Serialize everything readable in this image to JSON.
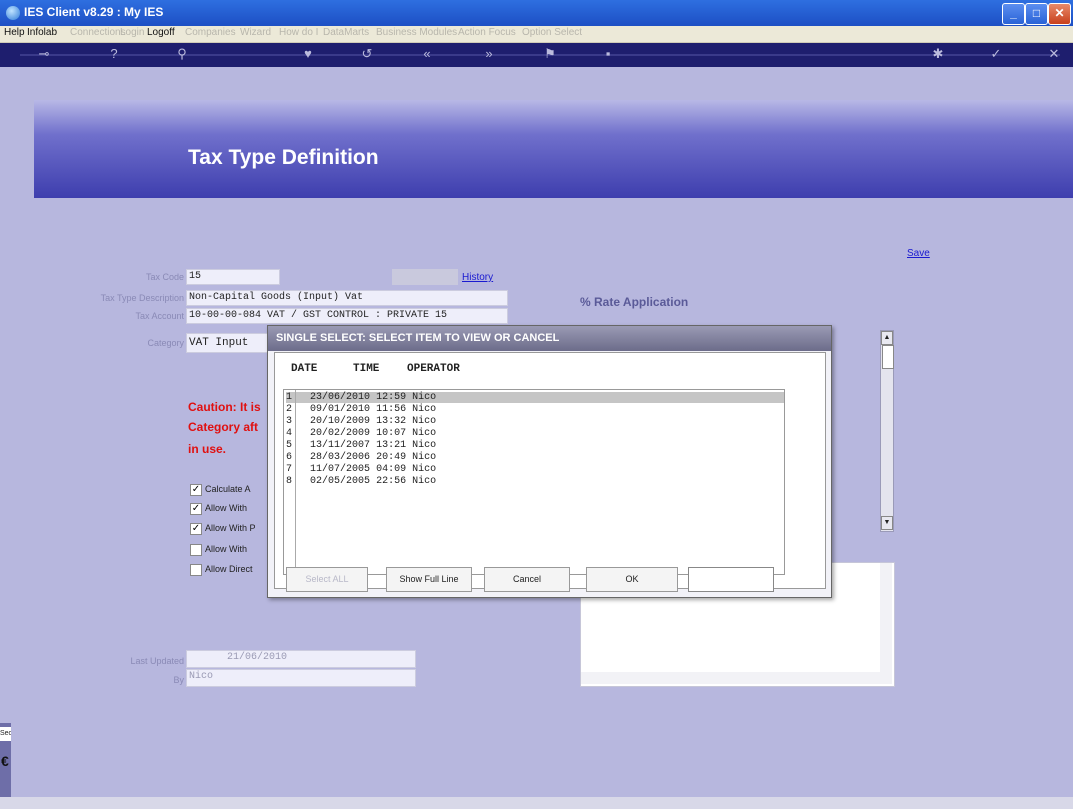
{
  "window": {
    "title": "IES Client v8.29 : My IES",
    "controls": {
      "minimize": "_",
      "maximize": "□",
      "close": "✕"
    }
  },
  "menubar": {
    "items": [
      {
        "label": "Help",
        "enabled": true
      },
      {
        "label": "Infolab",
        "enabled": true
      },
      {
        "label": "Connections",
        "enabled": false
      },
      {
        "label": "Login",
        "enabled": false
      },
      {
        "label": "Logoff",
        "enabled": true
      },
      {
        "label": "Companies",
        "enabled": false
      },
      {
        "label": "Wizard",
        "enabled": false
      },
      {
        "label": "How do I",
        "enabled": false
      },
      {
        "label": "DataMarts",
        "enabled": false
      },
      {
        "label": "Business Modules",
        "enabled": false
      },
      {
        "label": "Action Focus",
        "enabled": false
      },
      {
        "label": "Option Select",
        "enabled": false
      }
    ]
  },
  "toolbar": {
    "icons": [
      "key-icon",
      "help-icon",
      "search-icon",
      "heart-icon",
      "undo-icon",
      "rewind-icon",
      "fast-forward-icon",
      "flag-icon",
      "save-disk-icon",
      "settings-icon",
      "ok-icon",
      "close-icon"
    ]
  },
  "page": {
    "title": "Tax Type Definition",
    "save_link": "Save",
    "history_link": "History",
    "rate_application": "% Rate Application"
  },
  "form": {
    "tax_code": {
      "label": "Tax Code",
      "value": "15"
    },
    "description": {
      "label": "Tax Type Description",
      "value": "Non-Capital Goods (Input) Vat"
    },
    "tax_account": {
      "label": "Tax Account",
      "value": "10-00-00-084 VAT / GST CONTROL : PRIVATE 15"
    },
    "category": {
      "label": "Category",
      "value": "VAT Input"
    },
    "caution_lines": [
      "Caution: It is",
      "Category aft",
      "in use."
    ],
    "checkboxes": [
      {
        "label": "Calculate A",
        "checked": true
      },
      {
        "label": "Allow With",
        "checked": true
      },
      {
        "label": "Allow With P",
        "checked": true
      },
      {
        "label": "Allow With",
        "checked": false
      },
      {
        "label": "Allow Direct",
        "checked": false
      }
    ],
    "last_updated": {
      "label": "Last Updated",
      "value": "21/06/2010"
    },
    "by": {
      "label": "By",
      "value": "Nico"
    }
  },
  "dialog": {
    "title": "SINGLE SELECT: SELECT ITEM TO VIEW OR CANCEL",
    "columns": [
      "DATE",
      "TIME",
      "OPERATOR"
    ],
    "rows": [
      {
        "num": "1",
        "date": "23/06/2010",
        "time": "12:59",
        "operator": "Nico",
        "selected": true
      },
      {
        "num": "2",
        "date": "09/01/2010",
        "time": "11:56",
        "operator": "Nico",
        "selected": false
      },
      {
        "num": "3",
        "date": "20/10/2009",
        "time": "13:32",
        "operator": "Nico",
        "selected": false
      },
      {
        "num": "4",
        "date": "20/02/2009",
        "time": "10:07",
        "operator": "Nico",
        "selected": false
      },
      {
        "num": "5",
        "date": "13/11/2007",
        "time": "13:21",
        "operator": "Nico",
        "selected": false
      },
      {
        "num": "6",
        "date": "28/03/2006",
        "time": "20:49",
        "operator": "Nico",
        "selected": false
      },
      {
        "num": "7",
        "date": "11/07/2005",
        "time": "04:09",
        "operator": "Nico",
        "selected": false
      },
      {
        "num": "8",
        "date": "02/05/2005",
        "time": "22:56",
        "operator": "Nico",
        "selected": false
      }
    ],
    "buttons": {
      "select_all": "Select ALL",
      "show_full_line": "Show Full Line",
      "cancel": "Cancel",
      "ok": "OK"
    },
    "search_value": ""
  },
  "side": {
    "tab_label": "Sec",
    "glyph": "€"
  }
}
